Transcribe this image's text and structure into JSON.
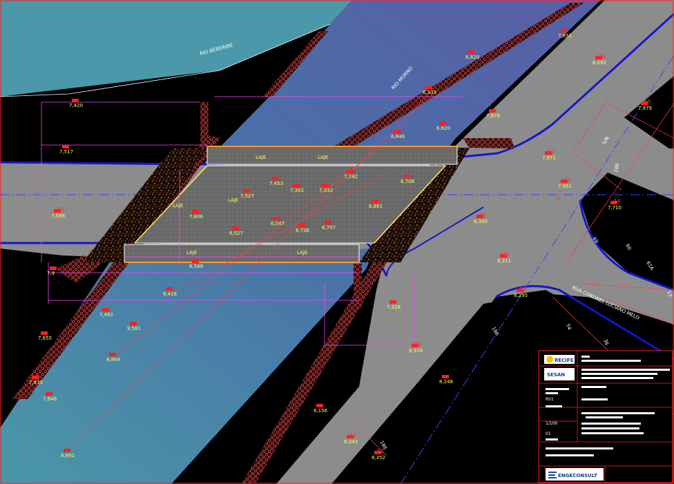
{
  "river_labels": {
    "beberibe": "RIO BEBERIBE",
    "morno": "RIO MORNO"
  },
  "street_labels": {
    "coronel": "RUA CORONEL LUCIANO MELO",
    "sn": "S/N"
  },
  "street_numbers": [
    "69",
    "60",
    "61A",
    "54",
    "36",
    "13",
    "186",
    "186",
    "186"
  ],
  "zero_label": "0",
  "bridge_labels": [
    "LAJE",
    "LAJE",
    "LAJE",
    "LAJE",
    "LAJE",
    "LAJE"
  ],
  "survey_points": [
    {
      "id": "",
      "elev": "7,420"
    },
    {
      "id": "",
      "elev": "7,517"
    },
    {
      "id": "10",
      "elev": "7,588"
    },
    {
      "id": "",
      "elev": "7,9"
    },
    {
      "id": "",
      "elev": "7,855"
    },
    {
      "id": "",
      "elev": "7,835"
    },
    {
      "id": "",
      "elev": "7,646"
    },
    {
      "id": "",
      "elev": "8,891"
    },
    {
      "id": "",
      "elev": "7,492"
    },
    {
      "id": "",
      "elev": "9,581"
    },
    {
      "id": "",
      "elev": "8,864"
    },
    {
      "id": "",
      "elev": "6,416"
    },
    {
      "id": "",
      "elev": "6,588"
    },
    {
      "id": "",
      "elev": "7,606"
    },
    {
      "id": "",
      "elev": "6,527"
    },
    {
      "id": "",
      "elev": "6,547"
    },
    {
      "id": "",
      "elev": "6,736"
    },
    {
      "id": "",
      "elev": "6,757"
    },
    {
      "id": "",
      "elev": "6,861"
    },
    {
      "id": "",
      "elev": "7,527"
    },
    {
      "id": "",
      "elev": "7,453"
    },
    {
      "id": "",
      "elev": "7,302"
    },
    {
      "id": "",
      "elev": "7,332"
    },
    {
      "id": "",
      "elev": "7,242"
    },
    {
      "id": "",
      "elev": "6,708"
    },
    {
      "id": "",
      "elev": "6,846"
    },
    {
      "id": "",
      "elev": "6,620"
    },
    {
      "id": "",
      "elev": "6,333"
    },
    {
      "id": "",
      "elev": "8,820"
    },
    {
      "id": "",
      "elev": "7,876"
    },
    {
      "id": "",
      "elev": "7,851"
    },
    {
      "id": "39",
      "elev": "8,092"
    },
    {
      "id": "38",
      "elev": "7,979"
    },
    {
      "id": "42",
      "elev": "7,971"
    },
    {
      "id": "45",
      "elev": "7,951"
    },
    {
      "id": "44",
      "elev": "7,710"
    },
    {
      "id": "46",
      "elev": "8,390"
    },
    {
      "id": "47",
      "elev": "8,311"
    },
    {
      "id": "48",
      "elev": "8,295"
    },
    {
      "id": "",
      "elev": "7,328"
    },
    {
      "id": "50",
      "elev": "8,316"
    },
    {
      "id": "",
      "elev": "8,248"
    },
    {
      "id": "",
      "elev": "8,156"
    },
    {
      "id": "53",
      "elev": "8,243"
    },
    {
      "id": "52",
      "elev": "8,352"
    }
  ],
  "title_block": {
    "client_logo": "RECIFE",
    "agency_logo": "SESAN",
    "company_logo": "ENGECONSULT",
    "revision": "R01",
    "scale": "1/100",
    "sheet": "01"
  },
  "colors": {
    "background": "#000000",
    "river_light": "#4a8fa8",
    "river_dark": "#5a63a8",
    "road": "#8c8c8c",
    "curb": "#1010c8",
    "dimension": "#ff44ff",
    "elevation_text": "#ffff66",
    "point_id": "#ff3030",
    "axis": "#3040ff"
  }
}
